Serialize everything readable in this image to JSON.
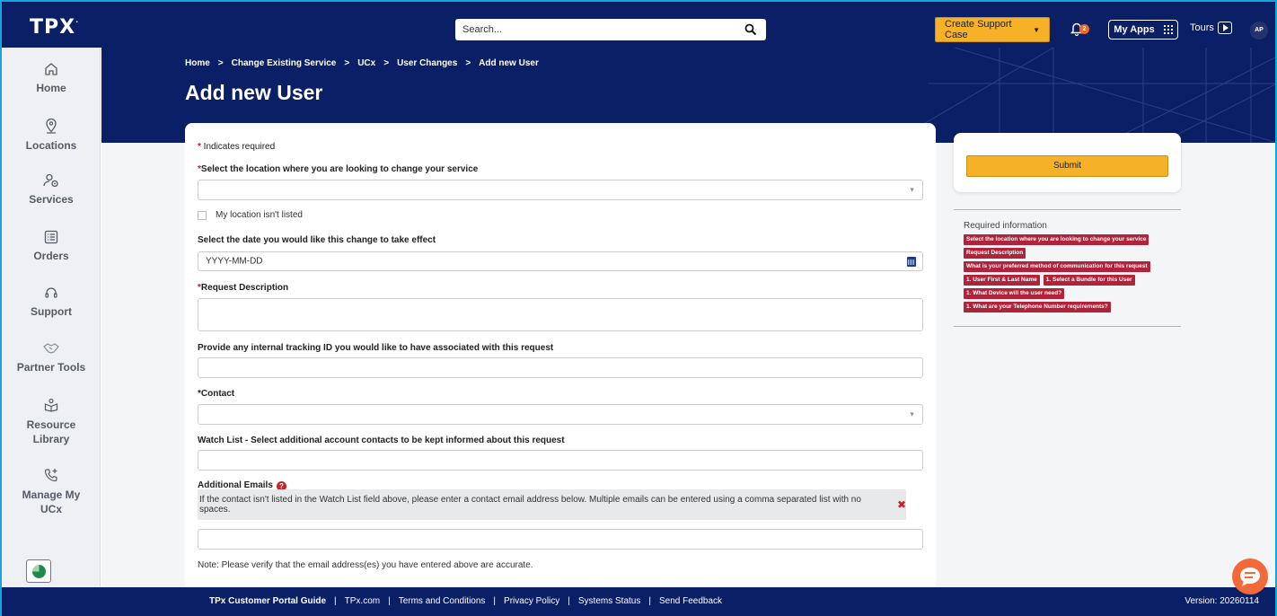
{
  "topbar": {
    "logo": "TPX",
    "logo_mark": ".",
    "search_placeholder": "Search...",
    "support_button": "Create Support Case",
    "notification_count": "2",
    "my_apps": "My Apps",
    "tours": "Tours",
    "avatar_initials": "AP"
  },
  "sidebar": {
    "items": [
      {
        "label": "Home",
        "icon": "home-icon"
      },
      {
        "label": "Locations",
        "icon": "location-pin-icon"
      },
      {
        "label": "Services",
        "icon": "services-icon"
      },
      {
        "label": "Orders",
        "icon": "orders-icon"
      },
      {
        "label": "Support",
        "icon": "support-icon"
      },
      {
        "label": "Partner Tools",
        "icon": "handshake-icon"
      },
      {
        "label": "Resource Library",
        "icon": "resource-library-icon"
      },
      {
        "label": "Manage My UCx",
        "icon": "phone-plus-icon"
      }
    ]
  },
  "hero": {
    "breadcrumb": [
      "Home",
      "Change Existing Service",
      "UCx",
      "User Changes",
      "Add new User"
    ],
    "title": "Add new User"
  },
  "form": {
    "required_note": "Indicates required",
    "location_label": "Select the location where you are looking to change your service",
    "location_value": "",
    "location_unlisted": "My location isn't listed",
    "date_label": "Select the date you would like this change to take effect",
    "date_placeholder": "YYYY-MM-DD",
    "description_label": "Request Description",
    "tracking_label": "Provide any internal tracking ID you would like to have associated with this request",
    "contact_label": "Contact",
    "watch_label": "Watch List - Select additional account contacts to be kept informed about this request",
    "emails_label": "Additional Emails",
    "emails_info": "If the contact isn't listed in the Watch List field above, please enter a contact email address below. Multiple emails can be entered using a comma separated list with no spaces.",
    "note": "Note: Please verify that the email address(es) you have entered above are accurate."
  },
  "panel": {
    "submit": "Submit",
    "required_title": "Required information",
    "chips": [
      [
        "Select the location where you are looking to change your service"
      ],
      [
        "Request Description"
      ],
      [
        "What is your preferred method of communication for this request"
      ],
      [
        "1. User First & Last Name",
        "1. Select a Bundle for this User"
      ],
      [
        "1. What Device will the user need?"
      ],
      [
        "1. What are your Telephone Number requirements?"
      ]
    ]
  },
  "footer": {
    "links": [
      "TPx Customer Portal Guide",
      "TPx.com",
      "Terms and Conditions",
      "Privacy Policy",
      "Systems Status",
      "Send Feedback"
    ],
    "version": "Version: 20260114"
  },
  "colors": {
    "navy": "#0b1f66",
    "accent_yellow": "#f5b228",
    "required_red": "#d11a2a",
    "chip_red": "#b0233a",
    "chat_orange": "#f26a3a"
  }
}
